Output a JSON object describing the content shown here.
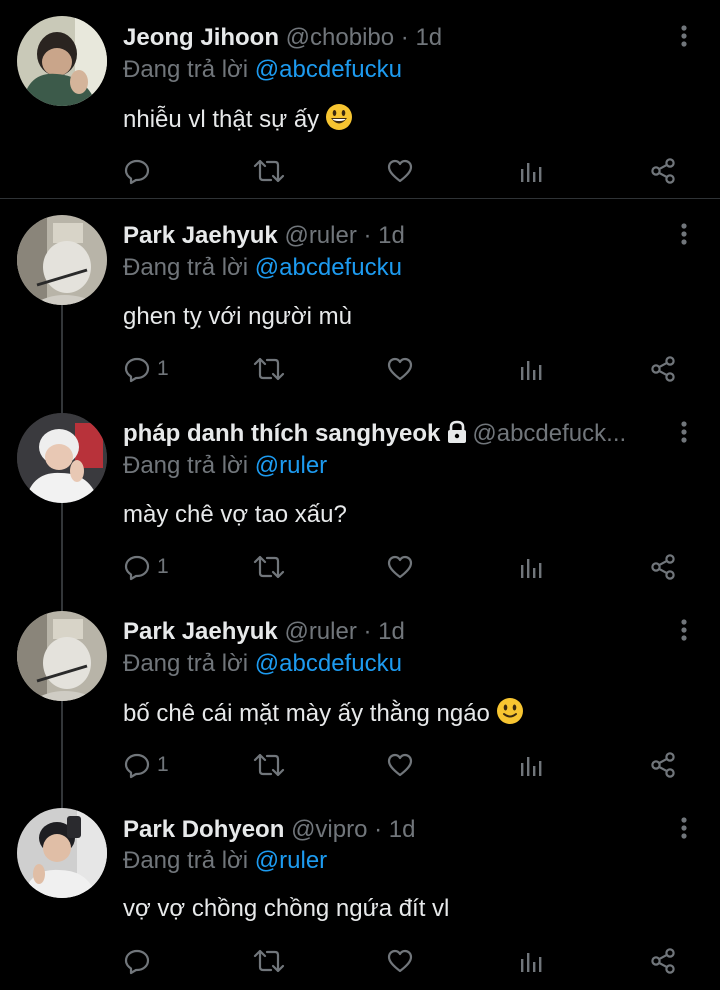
{
  "colors": {
    "background": "#000000",
    "text": "#e7e9ea",
    "muted": "#71767b",
    "link": "#1d9bf0",
    "divider": "#2f3336"
  },
  "reply_prefix": "Đang trả lời",
  "tweets": [
    {
      "name": "Jeong Jihoon",
      "handle": "@chobibo",
      "sep": "·",
      "time": "1d",
      "reply_to": "@abcdefucku",
      "text": "nhiễu vl thật sự ấy",
      "emoji": "grinning-face-emoji",
      "reply_count": "",
      "locked": false
    },
    {
      "name": "Park Jaehyuk",
      "handle": "@ruler",
      "sep": "·",
      "time": "1d",
      "reply_to": "@abcdefucku",
      "text": "ghen tỵ với người mù",
      "emoji": "",
      "reply_count": "1",
      "locked": false
    },
    {
      "name": "pháp danh thích sanghyeok",
      "handle": "@abcdefuck...",
      "sep": "",
      "time": "",
      "reply_to": "@ruler",
      "text": "mày chê vợ tao xấu?",
      "emoji": "",
      "reply_count": "1",
      "locked": true
    },
    {
      "name": "Park Jaehyuk",
      "handle": "@ruler",
      "sep": "·",
      "time": "1d",
      "reply_to": "@abcdefucku",
      "text": "bố chê cái mặt mày ấy thằng ngáo",
      "emoji": "slightly-smiling-face-emoji",
      "reply_count": "1",
      "locked": false
    },
    {
      "name": "Park Dohyeon",
      "handle": "@vipro",
      "sep": "·",
      "time": "1d",
      "reply_to": "@ruler",
      "text": "vợ vợ chồng chồng ngứa đít vl",
      "emoji": "",
      "reply_count": "",
      "locked": false
    }
  ],
  "action_icons": [
    "reply-icon",
    "retweet-icon",
    "like-icon",
    "views-icon",
    "share-icon"
  ]
}
